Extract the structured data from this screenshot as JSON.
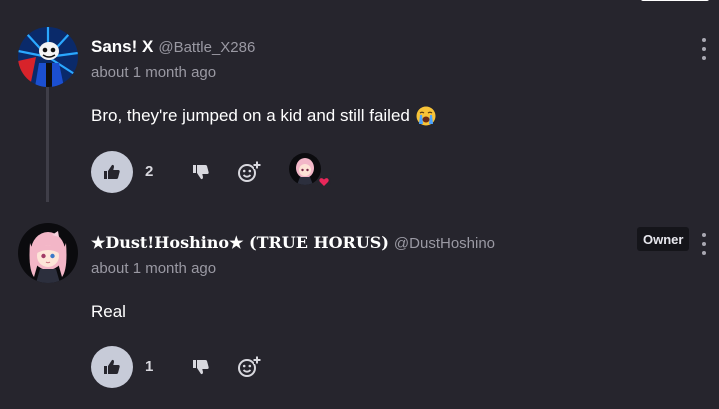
{
  "comments": [
    {
      "author": "Sans! X",
      "handle": "@Battle_X286",
      "timestamp": "about 1 month ago",
      "text": "Bro, they're jumped on a kid and still failed",
      "emoji": "loudly-crying-face",
      "likes": "2",
      "has_reaction_avatar": true,
      "reaction": "heart"
    },
    {
      "author": "★Dust!Hoshino★ (TRUE HORUS)",
      "handle": "@DustHoshino",
      "timestamp": "about 1 month ago",
      "text": "Real",
      "badge": "Owner",
      "likes": "1"
    }
  ],
  "colors": {
    "background": "#26252d",
    "like_button": "#c7cbd8",
    "heart": "#e8275a",
    "muted_text": "#9a99a3"
  }
}
